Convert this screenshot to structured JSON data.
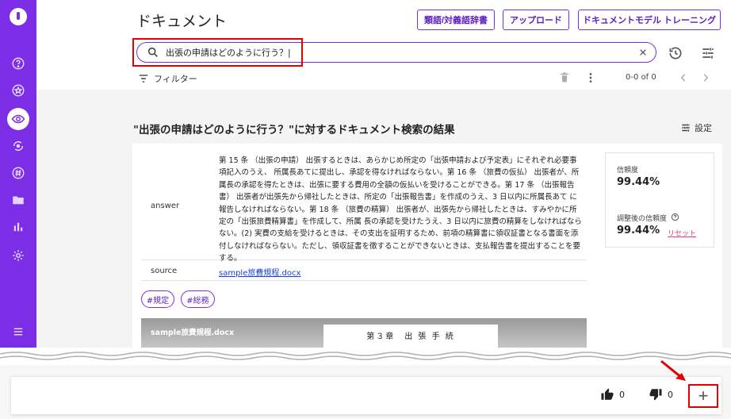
{
  "header": {
    "title": "ドキュメント",
    "btn_dictionary": "類語/対義語辞書",
    "btn_upload": "アップロード",
    "btn_training": "ドキュメントモデル トレーニング"
  },
  "search": {
    "value": "出張の申請はどのように行う？|"
  },
  "filter": {
    "label": "フィルター",
    "page_count": "0-0 of 0"
  },
  "results": {
    "title": "\"出張の申請はどのように行う？\"に対するドキュメント検索の結果",
    "settings_label": "設定",
    "answer_label": "answer",
    "answer_text": "第 15 条 （出張の申請） 出張するときは、あらかじめ所定の「出張申請および予定表」にそれぞれ必要事項記入のうえ、 所属長あてに提出し、承認を得なければならない。第 16 条 （旅費の仮払） 出張者が、所属長の承認を得たときは、出張に要する費用の全額の仮払いを受けることができる。第 17 条 （出張報告書） 出張者が出張先から帰社したときは、所定の「出張報告書」を作成のうえ、3 日以内に所属長あて に報告しなければならない。第 18 条 （旅費の精算） 出張者が、出張先から帰社したときは、すみやかに所定の「出張旅費精算書」を作成して、所属 長の承認を受けたうえ、3 日以内に旅費の精算をしなければならない。(2) 実費の支給を受けるときは、その支出を証明するため、前項の精算書に領収証書となる書面を添 付しなければならない。ただし、領収証書を徴することができないときは、支払報告書を提出することを要する。",
    "source_label": "source",
    "source_link": "sample旅費規程.docx",
    "tags": [
      "#規定",
      "#総務"
    ],
    "preview_name": "sample旅費規程.docx",
    "preview_chapter": "第３章　出 張 手 続"
  },
  "scores": {
    "confidence_label": "信頼度",
    "confidence_value": "99.44%",
    "adjusted_label": "調整後の信頼度",
    "adjusted_value": "99.44%",
    "reset_label": "リセット"
  },
  "feedback": {
    "up_count": "0",
    "down_count": "0",
    "add_label": "+"
  },
  "colors": {
    "accent": "#7b2ee6",
    "highlight": "#e00000"
  }
}
